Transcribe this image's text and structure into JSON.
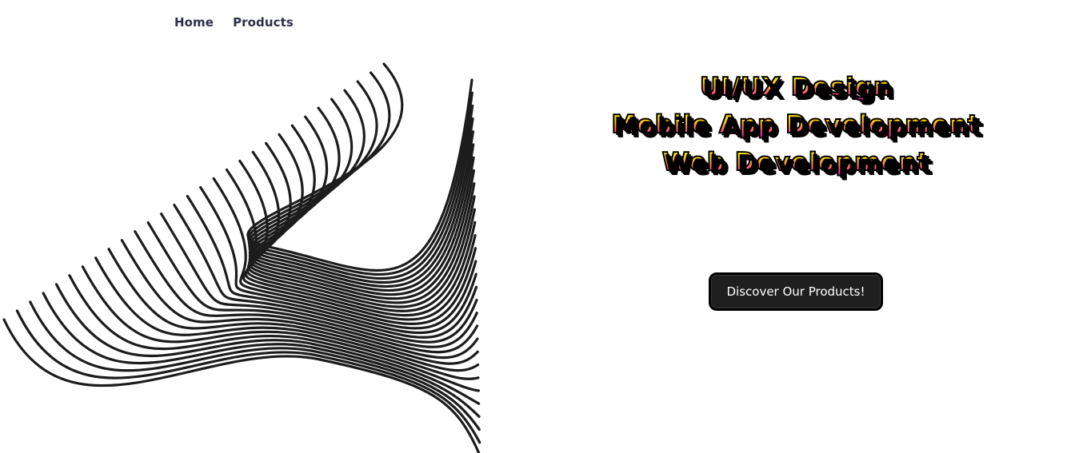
{
  "nav": {
    "items": [
      {
        "label": "Home"
      },
      {
        "label": "Products"
      }
    ]
  },
  "hero": {
    "lines": [
      "UI/UX Design",
      "Mobile App Development",
      "Web Development"
    ],
    "cta_label": "Discover Our Products!"
  },
  "colors": {
    "gradient_top": "#ffff33",
    "gradient_bottom": "#ff008c",
    "outline": "#000000",
    "button_bg": "#1f1f1f",
    "nav_text": "#2f2f4a"
  }
}
